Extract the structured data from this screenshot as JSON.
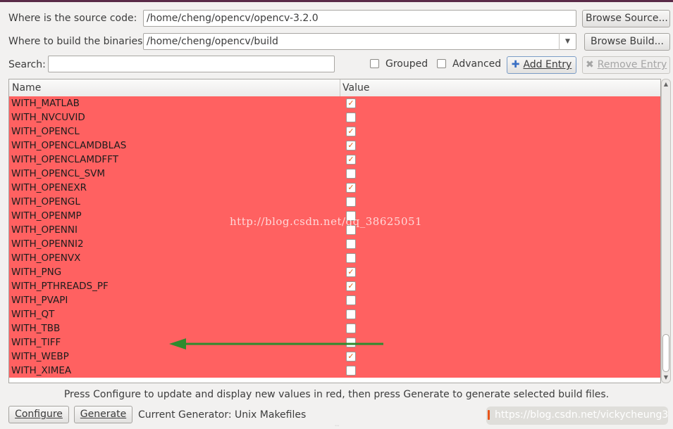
{
  "source": {
    "label": "Where is the source code:",
    "value": "/home/cheng/opencv/opencv-3.2.0",
    "browse_label": "Browse Source..."
  },
  "build": {
    "label": "Where to build the binaries:",
    "value": "/home/cheng/opencv/build",
    "browse_label": "Browse Build..."
  },
  "search": {
    "label": "Search:",
    "value": "",
    "grouped_label": "Grouped",
    "grouped_checked": false,
    "advanced_label": "Advanced",
    "advanced_checked": false,
    "add_entry_label": "Add Entry",
    "remove_entry_label": "Remove Entry"
  },
  "table": {
    "col_name": "Name",
    "col_value": "Value",
    "row_color": "#ff6161",
    "rows": [
      {
        "name": "WITH_MATLAB",
        "checked": true
      },
      {
        "name": "WITH_NVCUVID",
        "checked": false
      },
      {
        "name": "WITH_OPENCL",
        "checked": true
      },
      {
        "name": "WITH_OPENCLAMDBLAS",
        "checked": true
      },
      {
        "name": "WITH_OPENCLAMDFFT",
        "checked": true
      },
      {
        "name": "WITH_OPENCL_SVM",
        "checked": false
      },
      {
        "name": "WITH_OPENEXR",
        "checked": true
      },
      {
        "name": "WITH_OPENGL",
        "checked": false
      },
      {
        "name": "WITH_OPENMP",
        "checked": false
      },
      {
        "name": "WITH_OPENNI",
        "checked": false
      },
      {
        "name": "WITH_OPENNI2",
        "checked": false
      },
      {
        "name": "WITH_OPENVX",
        "checked": false
      },
      {
        "name": "WITH_PNG",
        "checked": true
      },
      {
        "name": "WITH_PTHREADS_PF",
        "checked": true
      },
      {
        "name": "WITH_PVAPI",
        "checked": false
      },
      {
        "name": "WITH_QT",
        "checked": false
      },
      {
        "name": "WITH_TBB",
        "checked": false
      },
      {
        "name": "WITH_TIFF",
        "checked": false
      },
      {
        "name": "WITH_WEBP",
        "checked": true
      },
      {
        "name": "WITH_XIMEA",
        "checked": false
      }
    ]
  },
  "watermark": "http://blog.csdn.net/qq_38625051",
  "status_text": "Press Configure to update and display new values in red, then press Generate to generate selected build files.",
  "footer": {
    "configure_label": "Configure",
    "generate_label": "Generate",
    "generator_text": "Current Generator: Unix Makefiles",
    "watermark": "https://blog.csdn.net/vickycheung3"
  },
  "annotation_color": "#2e8b2e"
}
